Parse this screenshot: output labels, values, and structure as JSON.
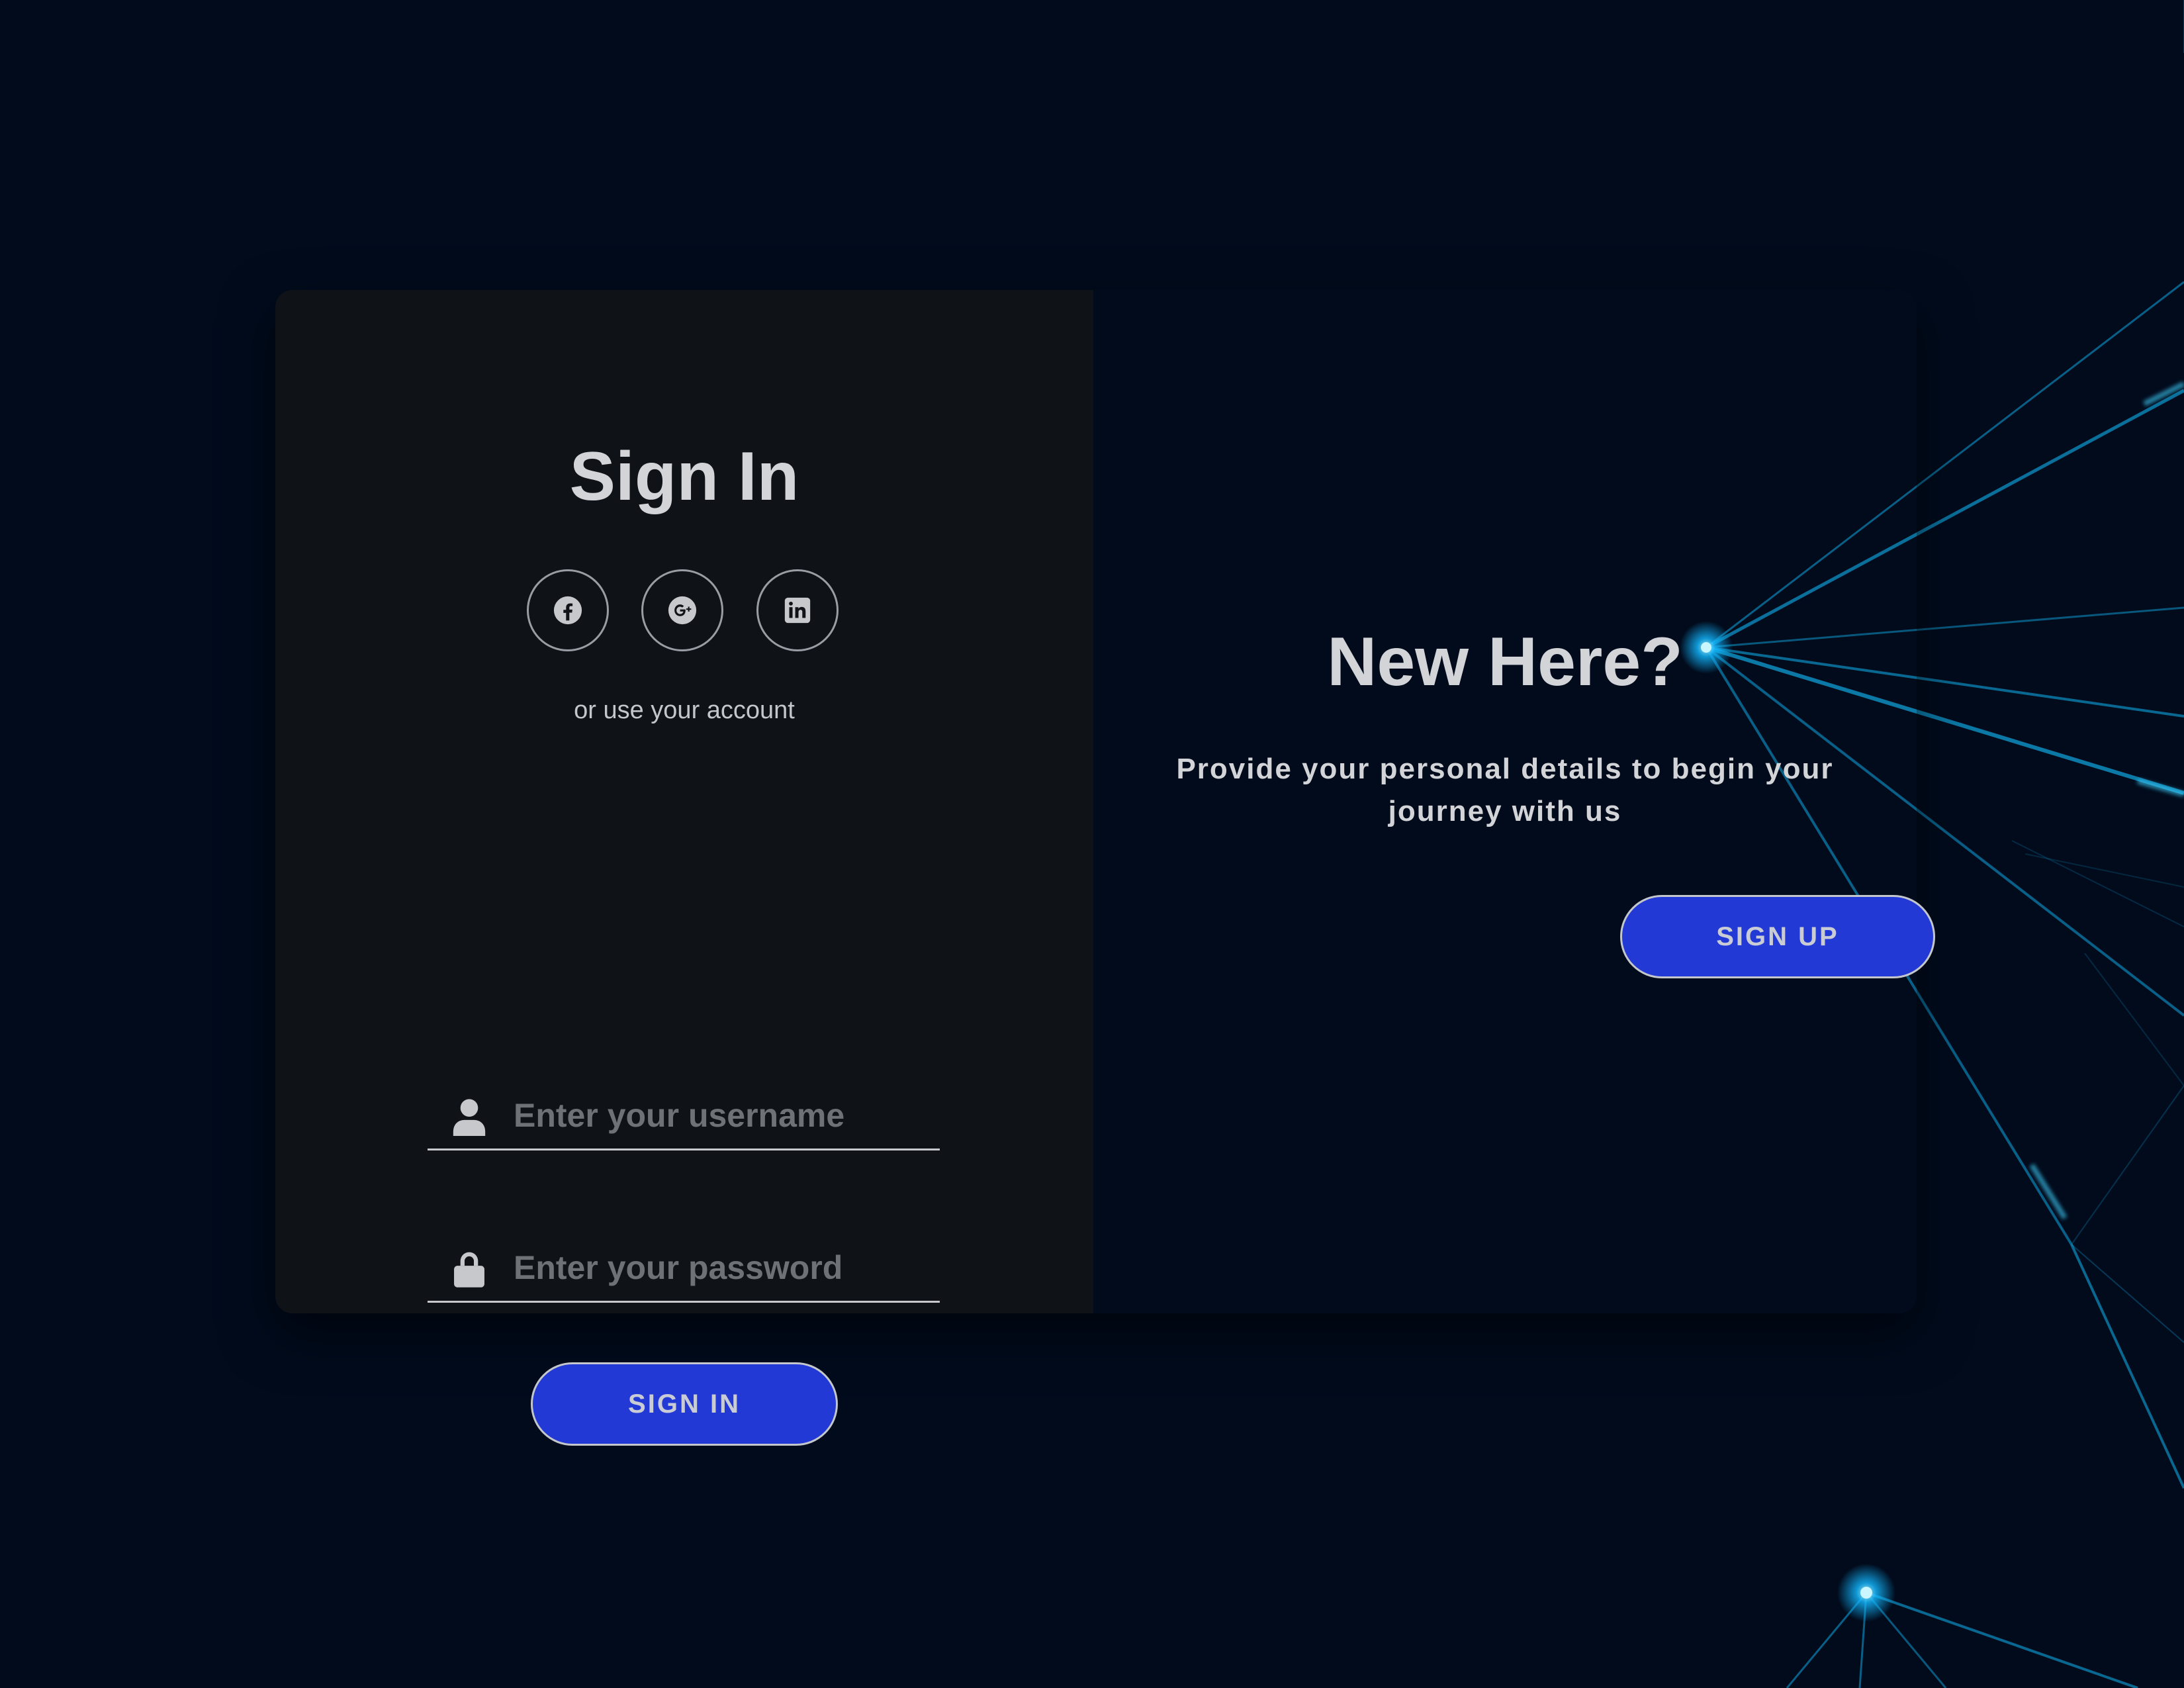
{
  "sign_in": {
    "title": "Sign In",
    "social_buttons": [
      {
        "icon": "facebook-icon"
      },
      {
        "icon": "google-plus-icon"
      },
      {
        "icon": "linkedin-icon"
      }
    ],
    "alt_text": "or use your account",
    "username": {
      "placeholder": "Enter your username",
      "value": "",
      "icon": "user-icon"
    },
    "password": {
      "placeholder": "Enter your password",
      "value": "",
      "icon": "lock-icon"
    },
    "button_label": "SIGN IN"
  },
  "sign_up": {
    "title": "New Here?",
    "description": "Provide your personal details to begin your journey with us",
    "button_label": "SIGN UP"
  },
  "colors": {
    "page_background": "#010b1c",
    "left_panel": "#0f1318",
    "button": "#2239d6",
    "text": "#d2d4d8",
    "glow": "#12b7ff"
  }
}
